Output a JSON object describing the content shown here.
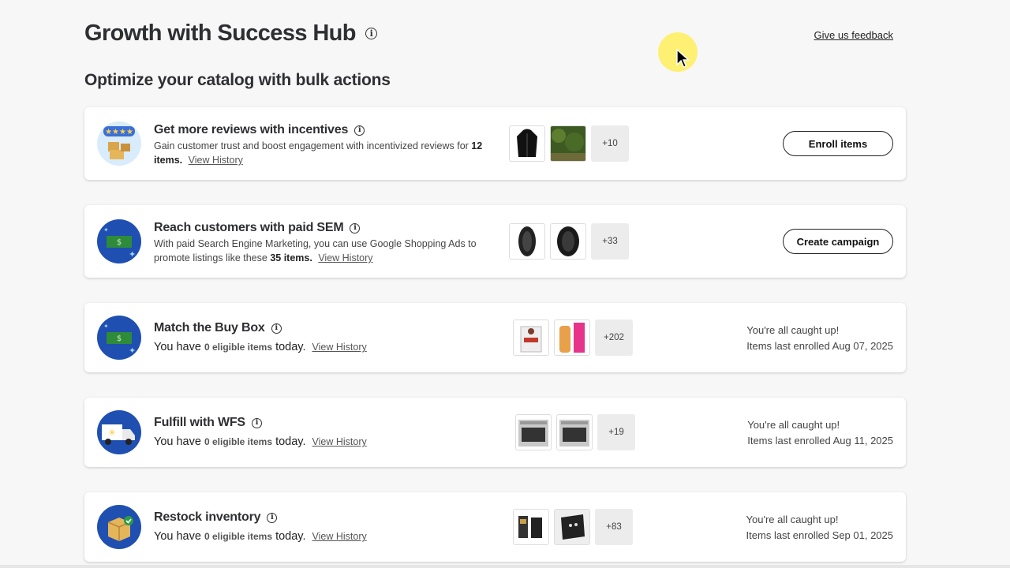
{
  "header": {
    "title": "Growth with Success Hub",
    "feedback_link": "Give us feedback"
  },
  "section": {
    "title": "Optimize your catalog with bulk actions"
  },
  "cards": [
    {
      "title": "Get more reviews with incentives",
      "desc_prefix": "Gain customer trust and boost engagement with incentivized reviews for",
      "desc_count": "12 items.",
      "view_history": "View History",
      "more": "+10",
      "button": "Enroll items"
    },
    {
      "title": "Reach customers with paid SEM",
      "desc_prefix": "With paid Search Engine Marketing, you can use Google Shopping Ads to promote listings like these",
      "desc_count": "35 items.",
      "view_history": "View History",
      "more": "+33",
      "button": "Create campaign"
    },
    {
      "title": "Match the Buy Box",
      "elig_prefix": "You have",
      "elig_count": "0 eligible items",
      "elig_suffix": "today.",
      "view_history": "View History",
      "more": "+202",
      "status_line1": "You're all caught up!",
      "status_line2": "Items last enrolled Aug 07, 2025"
    },
    {
      "title": "Fulfill with WFS",
      "elig_prefix": "You have",
      "elig_count": "0 eligible items",
      "elig_suffix": "today.",
      "view_history": "View History",
      "more": "+19",
      "status_line1": "You're all caught up!",
      "status_line2": "Items last enrolled Aug 11, 2025"
    },
    {
      "title": "Restock inventory",
      "elig_prefix": "You have",
      "elig_count": "0 eligible items",
      "elig_suffix": "today.",
      "view_history": "View History",
      "more": "+83",
      "status_line1": "You're all caught up!",
      "status_line2": "Items last enrolled Sep 01, 2025"
    }
  ],
  "colors": {
    "badge_blue": "#1f4fb0",
    "badge_light": "#d9ecfb",
    "money_green": "#2e8b3a"
  }
}
